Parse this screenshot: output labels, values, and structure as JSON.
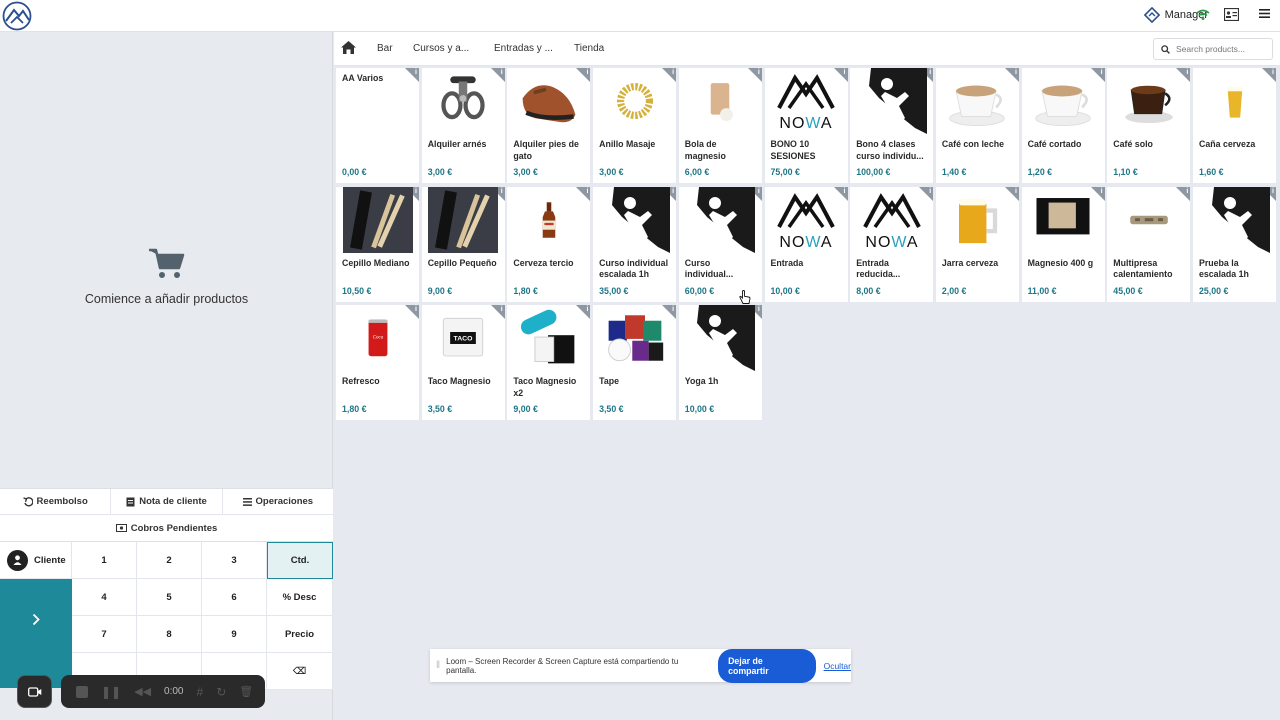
{
  "topbar": {
    "user": "Manager"
  },
  "nav": {
    "tabs": [
      "Bar",
      "Cursos y a...",
      "Entradas y ...",
      "Tienda"
    ],
    "search_placeholder": "Search products..."
  },
  "order": {
    "empty_message": "Comience a añadir productos"
  },
  "actions": {
    "refund": "Reembolso",
    "note": "Nota de cliente",
    "operations": "Operaciones",
    "pending": "Cobros Pendientes"
  },
  "numpad": {
    "customer": "Cliente",
    "keys": [
      "1",
      "2",
      "3",
      "Ctd.",
      "4",
      "5",
      "6",
      "% Desc",
      "7",
      "8",
      "9",
      "Precio",
      "",
      "",
      "",
      "⌫"
    ]
  },
  "products": [
    {
      "name": "AA Varios",
      "price": "0,00 €",
      "image": "none"
    },
    {
      "name": "Alquiler arnés",
      "price": "3,00 €",
      "image": "harness"
    },
    {
      "name": "Alquiler pies de gato",
      "price": "3,00 €",
      "image": "climbing-shoe"
    },
    {
      "name": "Anillo Masaje",
      "price": "3,00 €",
      "image": "massage-ring"
    },
    {
      "name": "Bola de magnesio",
      "price": "6,00 €",
      "image": "chalk-bag"
    },
    {
      "name": "BONO 10 SESIONES",
      "price": "75,00 €",
      "image": "nowa-logo"
    },
    {
      "name": "Bono 4 clases curso individu...",
      "price": "100,00 €",
      "image": "climber"
    },
    {
      "name": "Café con leche",
      "price": "1,40 €",
      "image": "coffee-cup"
    },
    {
      "name": "Café cortado",
      "price": "1,20 €",
      "image": "coffee-cup"
    },
    {
      "name": "Café solo",
      "price": "1,10 €",
      "image": "espresso"
    },
    {
      "name": "Caña cerveza",
      "price": "1,60 €",
      "image": "beer-glass"
    },
    {
      "name": "Cepillo Mediano",
      "price": "10,50 €",
      "image": "brush"
    },
    {
      "name": "Cepillo Pequeño",
      "price": "9,00 €",
      "image": "brush"
    },
    {
      "name": "Cerveza tercio",
      "price": "1,80 €",
      "image": "beer-bottle"
    },
    {
      "name": "Curso individual escalada 1h",
      "price": "35,00 €",
      "image": "climber"
    },
    {
      "name": "Curso individual...",
      "price": "60,00 €",
      "image": "climber"
    },
    {
      "name": "Entrada",
      "price": "10,00 €",
      "image": "nowa-logo"
    },
    {
      "name": "Entrada reducida...",
      "price": "8,00 €",
      "image": "nowa-logo"
    },
    {
      "name": "Jarra cerveza",
      "price": "2,00 €",
      "image": "beer-mug"
    },
    {
      "name": "Magnesio 400 g",
      "price": "11,00 €",
      "image": "chalk-pack"
    },
    {
      "name": "Multipresa calentamiento",
      "price": "45,00 €",
      "image": "hangboard"
    },
    {
      "name": "Prueba la escalada 1h",
      "price": "25,00 €",
      "image": "climber"
    },
    {
      "name": "Refresco",
      "price": "1,80 €",
      "image": "soda-can"
    },
    {
      "name": "Taco Magnesio",
      "price": "3,50 €",
      "image": "chalk-block"
    },
    {
      "name": "Taco Magnesio x2",
      "price": "9,00 €",
      "image": "chalk-block-pair"
    },
    {
      "name": "Tape",
      "price": "3,50 €",
      "image": "tape-rolls"
    },
    {
      "name": "Yoga 1h",
      "price": "10,00 €",
      "image": "climber"
    }
  ],
  "loom": {
    "message": "Loom – Screen Recorder & Screen Capture está compartiendo tu pantalla.",
    "stop": "Dejar de compartir",
    "hide": "Ocultar"
  },
  "recorder": {
    "time": "0:00"
  },
  "colors": {
    "accent": "#1e8a99",
    "price": "#1f7686",
    "loom_blue": "#1a5bd6"
  }
}
